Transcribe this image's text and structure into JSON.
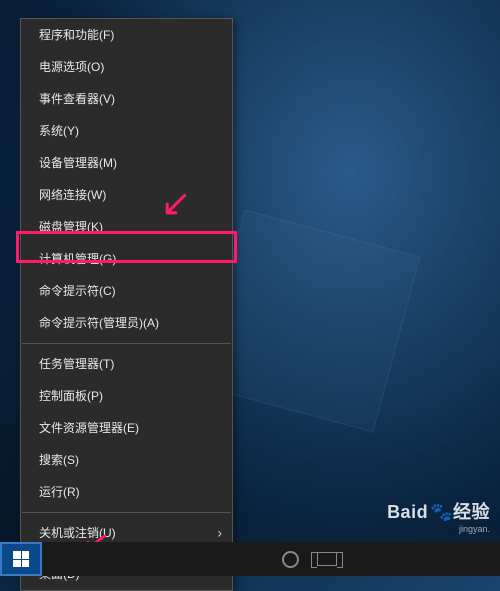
{
  "menu": {
    "items": [
      {
        "label": "程序和功能(F)"
      },
      {
        "label": "电源选项(O)"
      },
      {
        "label": "事件查看器(V)"
      },
      {
        "label": "系统(Y)"
      },
      {
        "label": "设备管理器(M)"
      },
      {
        "label": "网络连接(W)"
      },
      {
        "label": "磁盘管理(K)"
      },
      {
        "label": "计算机管理(G)"
      },
      {
        "label": "命令提示符(C)"
      },
      {
        "label": "命令提示符(管理员)(A)"
      },
      {
        "label": "任务管理器(T)"
      },
      {
        "label": "控制面板(P)"
      },
      {
        "label": "文件资源管理器(E)"
      },
      {
        "label": "搜索(S)"
      },
      {
        "label": "运行(R)"
      },
      {
        "label": "关机或注销(U)"
      },
      {
        "label": "桌面(D)"
      }
    ]
  },
  "highlight": {
    "color": "#ff1a6a",
    "target_label": "计算机管理(G)"
  },
  "watermark": {
    "brand": "Baid",
    "suffix": "经验",
    "sub": "jingyan."
  }
}
